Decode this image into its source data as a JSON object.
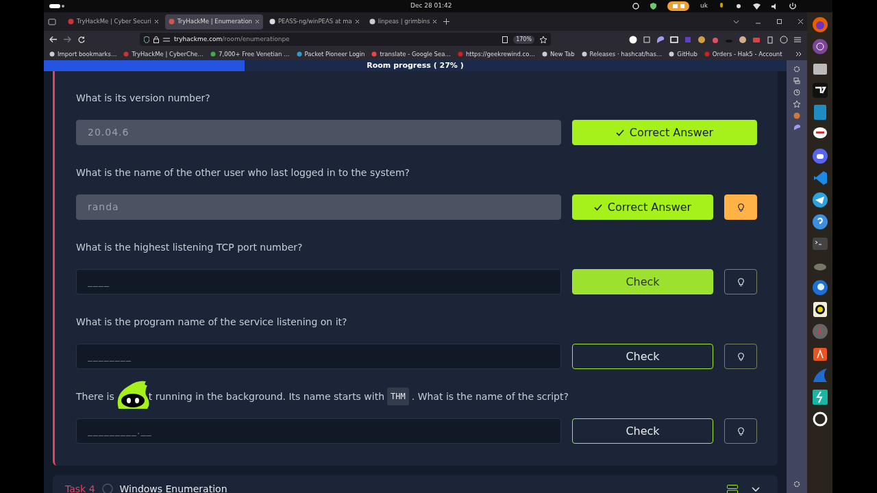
{
  "system_bar": {
    "date": "Dec 28  01:42",
    "language": "uk"
  },
  "tabs": [
    {
      "title": "TryHackMe | Cyber Securi",
      "selected": false
    },
    {
      "title": "TryHackMe | Enumeration",
      "selected": true
    },
    {
      "title": "PEASS-ng/winPEAS at ma",
      "selected": false
    },
    {
      "title": "linpeas | grimbins",
      "selected": false
    }
  ],
  "address_bar": {
    "host": "tryhackme.com",
    "path": "/room/enumerationpe",
    "zoom": "170%"
  },
  "bookmarks": [
    "Import bookmarks…",
    "TryHackMe | CyberChe…",
    "7,000+ Free Venetian …",
    "Packet Pioneer Login",
    "translate - Google Sea…",
    "https://geekrewind.co…",
    "New Tab",
    "Releases · hashcat/has…",
    "GitHub",
    "Orders - Hak5 - Account"
  ],
  "progress": {
    "label": "Room progress ( 27% )",
    "level": 0.27
  },
  "questions": [
    {
      "parts": [
        {
          "kind": "text",
          "text": "What is its version number?"
        }
      ],
      "answer": "20.04.6",
      "button": "Correct Answer",
      "correct": true,
      "hint_button": false
    },
    {
      "parts": [
        {
          "kind": "text",
          "text": "What is the name of the other user who last logged in to the system?"
        }
      ],
      "answer": "randa",
      "button": "Correct Answer",
      "correct": true,
      "hint_button": true,
      "hint_used": true
    },
    {
      "parts": [
        {
          "kind": "text",
          "text": "What is the highest listening TCP port number?"
        }
      ],
      "placeholder": "____",
      "button": "Check",
      "correct": false,
      "hovered": true,
      "hint_button": true,
      "hint_used": false
    },
    {
      "parts": [
        {
          "kind": "text",
          "text": "What is the program name of the service listening on it?"
        }
      ],
      "placeholder": "________",
      "button": "Check",
      "correct": false,
      "hovered": false,
      "hint_button": true,
      "hint_used": false
    },
    {
      "parts": [
        {
          "kind": "text",
          "text": "There is"
        },
        {
          "kind": "mascot"
        },
        {
          "kind": "text",
          "text": "t running in the background. Its name starts with"
        },
        {
          "kind": "code",
          "text": "THM"
        },
        {
          "kind": "text",
          "text": ". What is the name of the script?"
        }
      ],
      "placeholder": "_________.__",
      "button": "Check",
      "correct": false,
      "hovered": false,
      "hint_button": true,
      "hint_used": false
    }
  ],
  "next_task": {
    "label": "Task 4",
    "title": "Windows Enumeration",
    "completed": false
  }
}
